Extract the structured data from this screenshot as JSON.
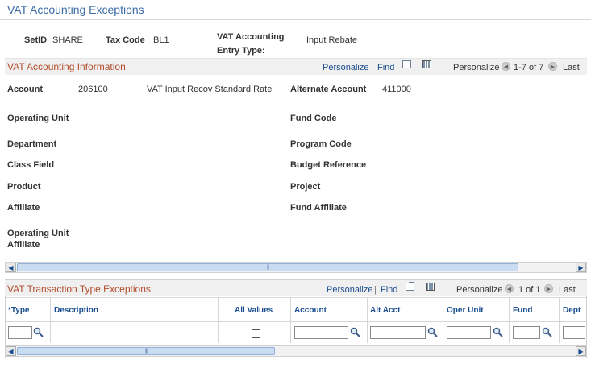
{
  "page": {
    "title": "VAT Accounting Exceptions"
  },
  "header": {
    "setid_label": "SetID",
    "setid_value": "SHARE",
    "taxcode_label": "Tax Code",
    "taxcode_value": "BL1",
    "entry_type_label_1": "VAT Accounting",
    "entry_type_label_2": "Entry Type:",
    "entry_type_value": "Input Rebate"
  },
  "acct_info": {
    "title": "VAT Accounting Information",
    "personalize": "Personalize",
    "sep": "|",
    "find": "Find",
    "personalize2": "Personalize",
    "range": "1-7 of 7",
    "last": "Last",
    "fields": {
      "account_label": "Account",
      "account_value": "206100",
      "account_desc": "VAT Input Recov Standard Rate",
      "alt_account_label": "Alternate Account",
      "alt_account_value": "411000",
      "operating_unit": "Operating Unit",
      "fund_code": "Fund Code",
      "department": "Department",
      "program_code": "Program Code",
      "class_field": "Class Field",
      "budget_reference": "Budget Reference",
      "product": "Product",
      "project": "Project",
      "affiliate": "Affiliate",
      "fund_affiliate": "Fund Affiliate",
      "op_unit_affiliate_1": "Operating Unit",
      "op_unit_affiliate_2": "Affiliate"
    }
  },
  "trans_exc": {
    "title": "VAT Transaction Type Exceptions",
    "personalize": "Personalize",
    "sep": "|",
    "find": "Find",
    "personalize2": "Personalize",
    "range": "1 of 1",
    "last": "Last",
    "columns": [
      "*Type",
      "Description",
      "All Values",
      "Account",
      "Alt Acct",
      "Oper Unit",
      "Fund",
      "Dept"
    ],
    "row": {
      "type": "",
      "account": "",
      "alt_acct": "",
      "oper_unit": "",
      "fund": "",
      "dept": "",
      "all_values": false
    }
  },
  "icons": {
    "lookup": "magnifier-icon",
    "prev": "circle-arrow-left-icon",
    "next": "circle-arrow-right-icon"
  }
}
